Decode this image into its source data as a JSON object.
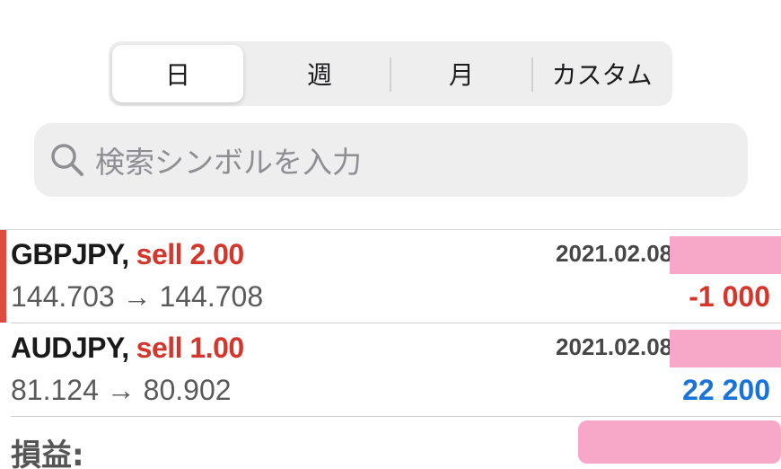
{
  "period_tabs": [
    {
      "label": "日",
      "active": true
    },
    {
      "label": "週",
      "active": false
    },
    {
      "label": "月",
      "active": false
    },
    {
      "label": "カスタム",
      "active": false
    }
  ],
  "search": {
    "placeholder": "検索シンボルを入力",
    "icon": "search-icon"
  },
  "orders": [
    {
      "symbol": "GBPJPY,",
      "side": "sell 2.00",
      "date": "2021.02.08",
      "prices": "144.703 → 144.708",
      "profit": "-1 000",
      "profit_color": "#d5362b"
    },
    {
      "symbol": "AUDJPY,",
      "side": "sell 1.00",
      "date": "2021.02.08",
      "prices": "81.124 → 80.902",
      "profit": "22 200",
      "profit_color": "#1a73d9"
    }
  ],
  "summary": {
    "profit_label": "損益:"
  },
  "colors": {
    "sell": "#d5362b",
    "loss": "#d5362b",
    "gain": "#1a73d9",
    "redaction": "#f7a8c8"
  }
}
